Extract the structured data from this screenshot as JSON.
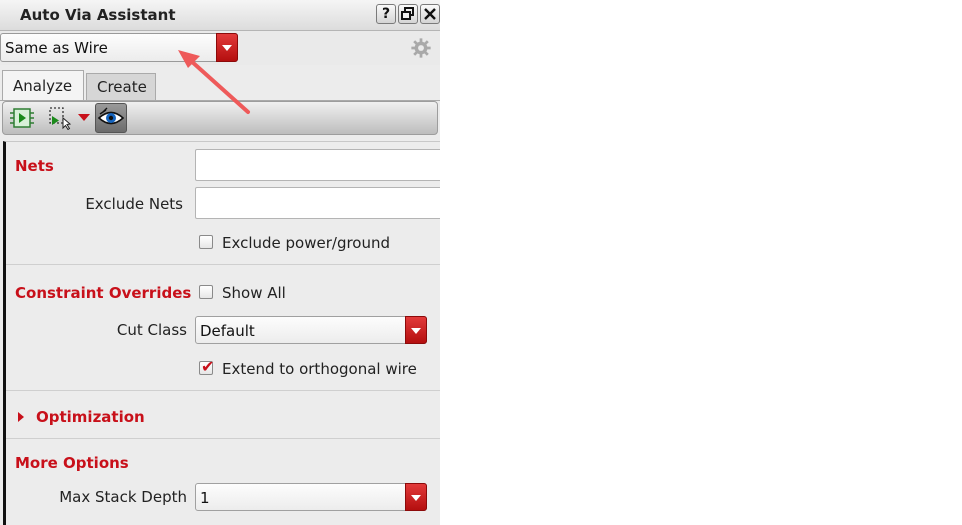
{
  "window": {
    "title": "Auto Via Assistant",
    "help_label": "?"
  },
  "preset": {
    "value": "Same as Wire"
  },
  "tabs": [
    {
      "label": "Analyze"
    },
    {
      "label": "Create"
    }
  ],
  "toolbar": {
    "icons": [
      "run-analysis-icon",
      "run-selected-icon",
      "dropdown-arrow-icon",
      "view-eye-icon"
    ]
  },
  "nets_section": {
    "heading": "Nets",
    "nets_value": "",
    "exclude_label": "Exclude Nets",
    "exclude_value": "",
    "exclude_power_label": "Exclude power/ground",
    "exclude_power_checked": false
  },
  "constraint_section": {
    "heading": "Constraint Overrides",
    "show_all_label": "Show All",
    "show_all_checked": false,
    "cut_class_label": "Cut Class",
    "cut_class_value": "Default",
    "extend_label": "Extend to orthogonal wire",
    "extend_checked": true
  },
  "optimization_section": {
    "heading": "Optimization",
    "expanded": false
  },
  "more_options": {
    "heading": "More Options",
    "max_stack_label": "Max Stack Depth",
    "max_stack_value": "1"
  },
  "colors": {
    "accent_red": "#c8101a",
    "annotation_arrow": "#ee5a5a"
  }
}
